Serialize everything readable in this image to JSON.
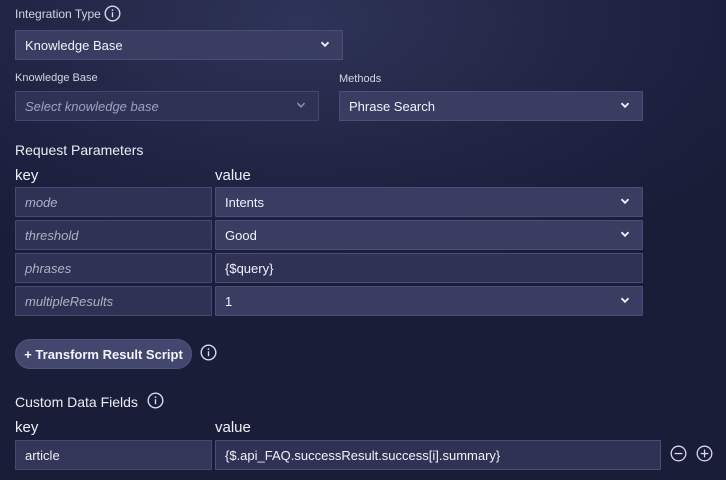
{
  "integration_type": {
    "label": "Integration Type",
    "value": "Knowledge Base"
  },
  "knowledge_base": {
    "label": "Knowledge Base",
    "placeholder": "Select knowledge base"
  },
  "methods": {
    "label": "Methods",
    "value": "Phrase Search"
  },
  "request_parameters": {
    "title": "Request Parameters",
    "key_header": "key",
    "value_header": "value",
    "rows": [
      {
        "key": "mode",
        "value": "Intents",
        "type": "select"
      },
      {
        "key": "threshold",
        "value": "Good",
        "type": "select"
      },
      {
        "key": "phrases",
        "value": "{$query}",
        "type": "text"
      },
      {
        "key": "multipleResults",
        "value": "1",
        "type": "select"
      }
    ]
  },
  "transform_button": {
    "label": "+ Transform Result Script"
  },
  "custom_data_fields": {
    "title": "Custom Data Fields",
    "key_header": "key",
    "value_header": "value",
    "rows": [
      {
        "key": "article",
        "value": "{$.api_FAQ.successResult.success[i].summary}"
      }
    ]
  },
  "icons": {
    "info": "info-icon",
    "chevron": "chevron-down-icon",
    "remove": "minus-circle-icon",
    "add": "plus-circle-icon"
  }
}
